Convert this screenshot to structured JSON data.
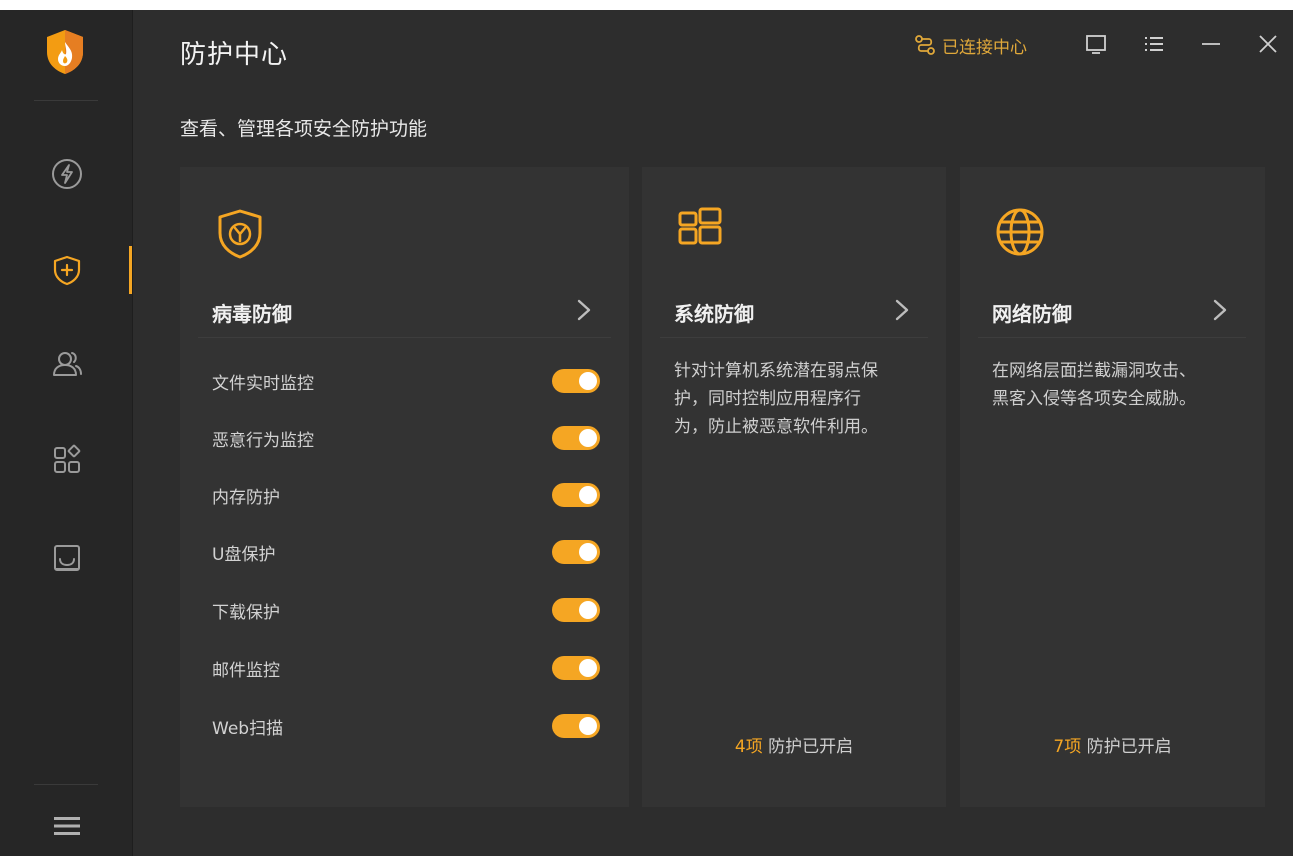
{
  "header": {
    "title": "防护中心",
    "subtitle": "查看、管理各项安全防护功能",
    "connect_label": "已连接中心"
  },
  "sidebar": {
    "items": [
      {
        "icon": "lightning-icon"
      },
      {
        "icon": "shield-plus-icon",
        "active": true
      },
      {
        "icon": "users-icon"
      },
      {
        "icon": "apps-icon"
      },
      {
        "icon": "inbox-icon"
      }
    ],
    "menu_icon": "hamburger-menu-icon"
  },
  "cards": {
    "virus": {
      "title": "病毒防御",
      "toggles": [
        {
          "label": "文件实时监控",
          "on": true
        },
        {
          "label": "恶意行为监控",
          "on": true
        },
        {
          "label": "内存防护",
          "on": true
        },
        {
          "label": "U盘保护",
          "on": true
        },
        {
          "label": "下载保护",
          "on": true
        },
        {
          "label": "邮件监控",
          "on": true
        },
        {
          "label": "Web扫描",
          "on": true
        }
      ]
    },
    "system": {
      "title": "系统防御",
      "desc_lines": [
        "针对计算机系统潜在弱点保",
        "护，同时控制应用程序行",
        "为，防止被恶意软件利用。"
      ],
      "status_count": "4项",
      "status_text": "防护已开启"
    },
    "network": {
      "title": "网络防御",
      "desc_lines": [
        "在网络层面拦截漏洞攻击、",
        "黑客入侵等各项安全威胁。"
      ],
      "status_count": "7项",
      "status_text": "防护已开启"
    }
  },
  "colors": {
    "accent": "#f5a623",
    "background": "#2d2d2d",
    "sidebar": "#262626",
    "card": "#333333"
  }
}
